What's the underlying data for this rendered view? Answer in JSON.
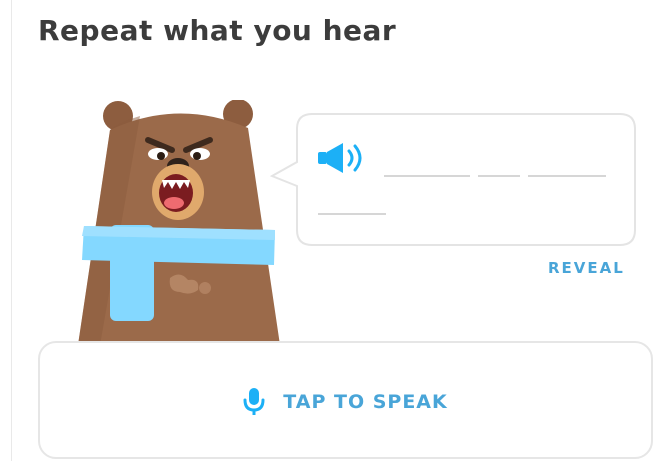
{
  "challenge": {
    "title": "Repeat what you hear"
  },
  "character": {
    "icon": "bear-with-scarf-illustration"
  },
  "speech_bubble": {
    "audio_icon": "speaker-icon",
    "blank_count": 4,
    "reveal_label": "REVEAL"
  },
  "speak_button": {
    "icon": "microphone-icon",
    "label": "TAP TO SPEAK"
  },
  "colors": {
    "accent": "#49a5d8",
    "speaker": "#1cb0f6",
    "title": "#3c3c3c",
    "bear_fur": "#9b6a4a",
    "scarf": "#84d8ff",
    "border": "#e6e6e6"
  }
}
